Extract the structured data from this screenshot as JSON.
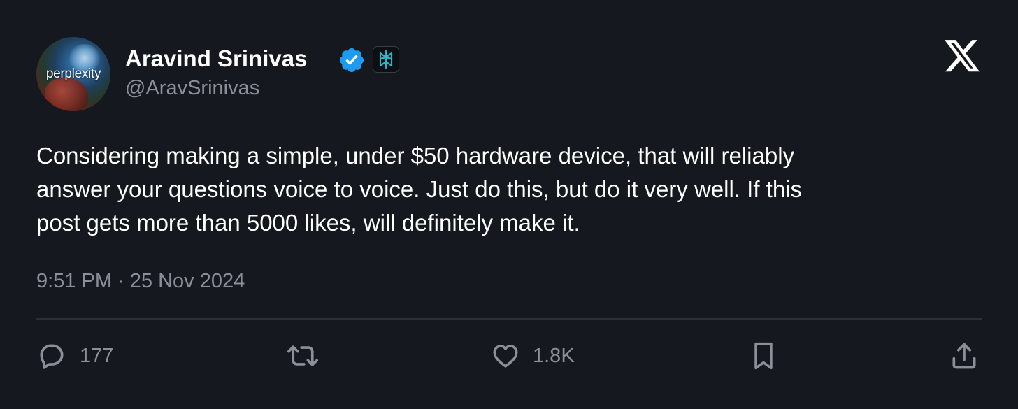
{
  "author": {
    "name": "Aravind Srinivas",
    "handle": "@AravSrinivas",
    "avatar_brand_text": "perplexity",
    "verified": true,
    "verified_color": "#1d9bf0",
    "affiliation_icon": "perplexity-logo-icon",
    "affiliation_color": "#2fb4c6"
  },
  "platform_icon": "x-logo-icon",
  "tweet": {
    "lines": [
      "Considering making a simple, under $50 hardware device, that will reliably",
      "answer your questions voice to voice. Just do this, but do it very well. If this",
      "post gets more than 5000 likes, will definitely make it."
    ],
    "timestamp": "9:51 PM · 25 Nov 2024"
  },
  "actions": {
    "reply": {
      "icon": "reply-icon",
      "count": "177"
    },
    "retweet": {
      "icon": "retweet-icon",
      "count": ""
    },
    "like": {
      "icon": "heart-icon",
      "count": "1.8K"
    },
    "bookmark": {
      "icon": "bookmark-icon"
    },
    "share": {
      "icon": "share-icon"
    }
  },
  "colors": {
    "background": "#15181e",
    "text_primary": "#ffffff",
    "text_secondary": "#8b9098",
    "divider": "#2b2f35"
  }
}
